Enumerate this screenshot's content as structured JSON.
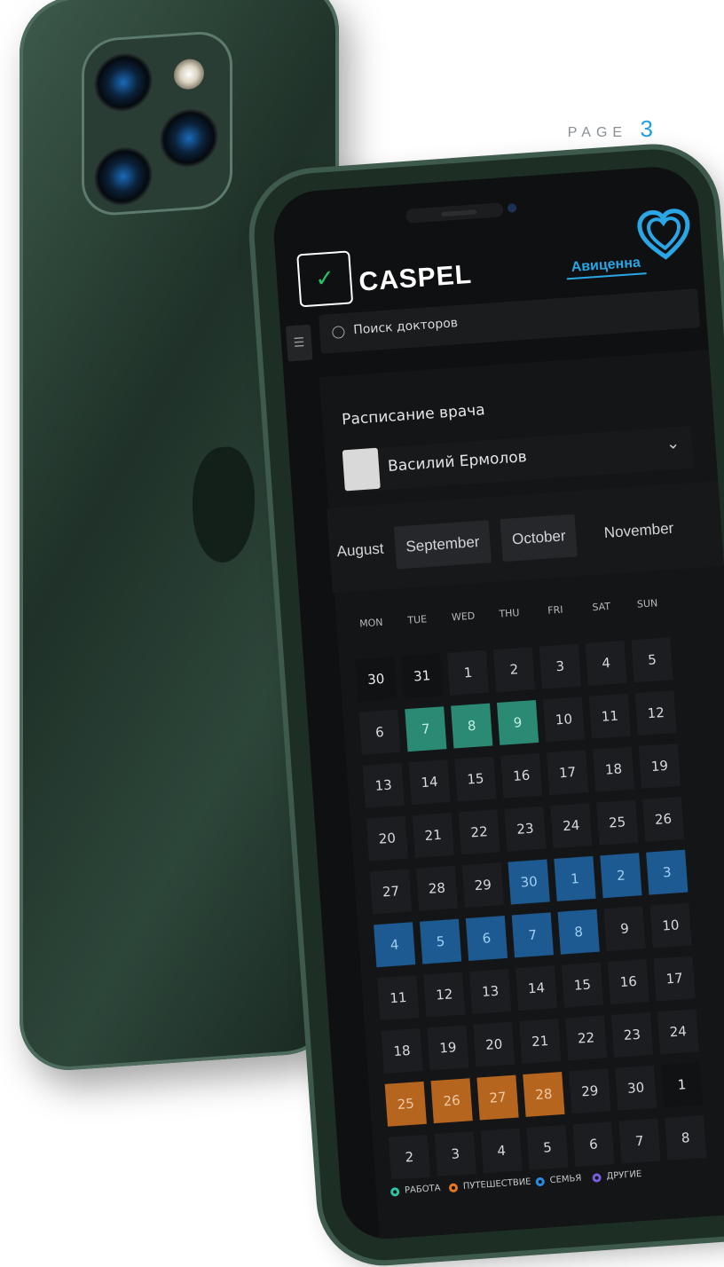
{
  "page": {
    "label": "PAGE",
    "number": "3"
  },
  "app": {
    "brand": "CASPEL",
    "partner": "Авиценна",
    "search": {
      "placeholder": "Поиск докторов"
    },
    "schedule": {
      "title": "Расписание врача",
      "doctor": "Василий Ермолов",
      "months": [
        "August",
        "September",
        "October",
        "November"
      ],
      "weekdays": [
        "MON",
        "TUE",
        "WED",
        "THU",
        "FRI",
        "SAT",
        "SUN"
      ],
      "weeks": [
        [
          "30",
          "31",
          "1",
          "2",
          "3",
          "4",
          "5"
        ],
        [
          "6",
          "7",
          "8",
          "9",
          "10",
          "11",
          "12"
        ],
        [
          "13",
          "14",
          "15",
          "16",
          "17",
          "18",
          "19"
        ],
        [
          "20",
          "21",
          "22",
          "23",
          "24",
          "25",
          "26"
        ],
        [
          "27",
          "28",
          "29",
          "30",
          "1",
          "2",
          "3"
        ],
        [
          "4",
          "5",
          "6",
          "7",
          "8",
          "9",
          "10"
        ],
        [
          "11",
          "12",
          "13",
          "14",
          "15",
          "16",
          "17"
        ],
        [
          "18",
          "19",
          "20",
          "21",
          "22",
          "23",
          "24"
        ],
        [
          "25",
          "26",
          "27",
          "28",
          "29",
          "30",
          "1"
        ],
        [
          "2",
          "3",
          "4",
          "5",
          "6",
          "7",
          "8"
        ]
      ],
      "highlights": {
        "green": [
          [
            1,
            1
          ],
          [
            1,
            2
          ],
          [
            1,
            3
          ]
        ],
        "blue": [
          [
            4,
            3
          ],
          [
            4,
            4
          ],
          [
            4,
            5
          ],
          [
            4,
            6
          ],
          [
            5,
            0
          ],
          [
            5,
            1
          ],
          [
            5,
            2
          ],
          [
            5,
            3
          ],
          [
            5,
            4
          ]
        ],
        "orange": [
          [
            8,
            0
          ],
          [
            8,
            1
          ],
          [
            8,
            2
          ],
          [
            8,
            3
          ]
        ],
        "dim": [
          [
            0,
            0
          ],
          [
            0,
            1
          ],
          [
            8,
            6
          ]
        ]
      }
    },
    "legend": [
      {
        "label": "РАБОТА",
        "color": "#2fc4a4"
      },
      {
        "label": "ПУТЕШЕСТВИЕ",
        "color": "#e8781d"
      },
      {
        "label": "СЕМЬЯ",
        "color": "#2a8ae0"
      },
      {
        "label": "ДРУГИЕ",
        "color": "#7a5de0"
      }
    ]
  }
}
